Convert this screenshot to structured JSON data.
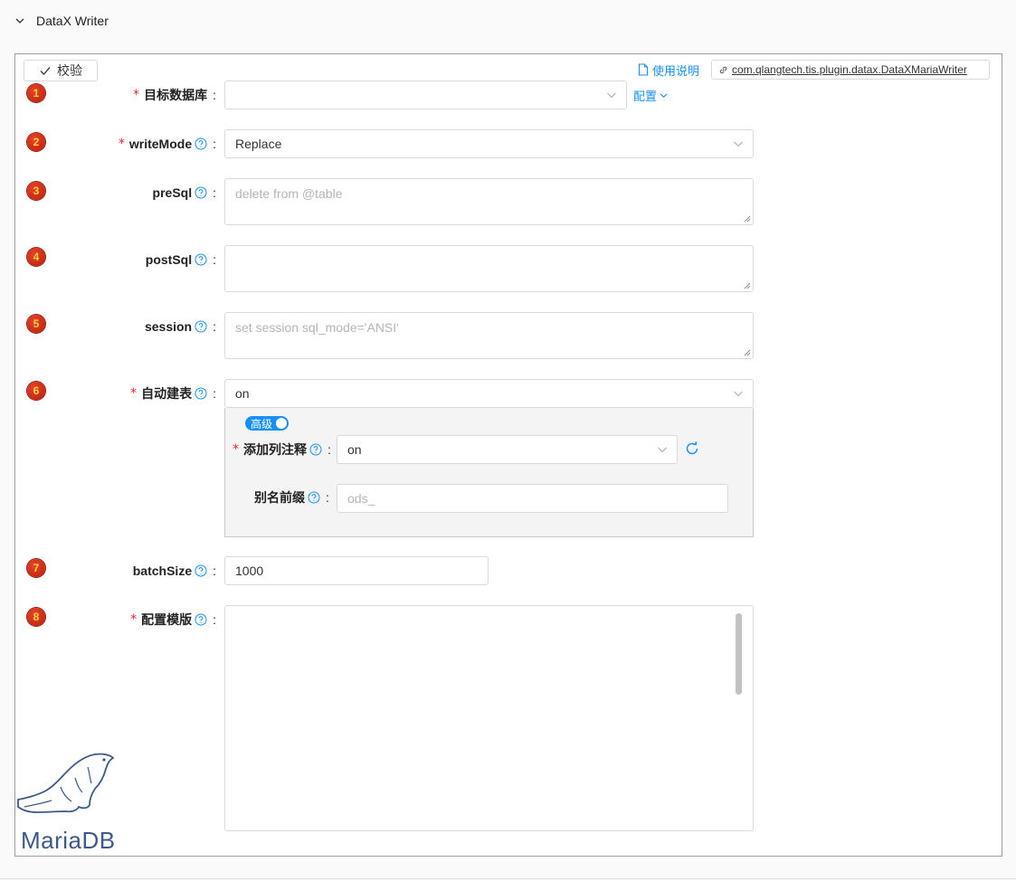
{
  "section": {
    "title": "DataX Writer"
  },
  "toolbar": {
    "verify_label": "校验",
    "doc_label": "使用说明",
    "plugin_class": "com.qlangtech.tis.plugin.datax.DataXMariaWriter"
  },
  "fields": {
    "target_db": {
      "index": "1",
      "label": "目标数据库",
      "value": "",
      "config_link": "配置"
    },
    "write_mode": {
      "index": "2",
      "label": "writeMode",
      "value": "Replace"
    },
    "pre_sql": {
      "index": "3",
      "label": "preSql",
      "placeholder": "delete from @table"
    },
    "post_sql": {
      "index": "4",
      "label": "postSql",
      "placeholder": ""
    },
    "session": {
      "index": "5",
      "label": "session",
      "placeholder": "set session sql_mode='ANSI'"
    },
    "auto_create": {
      "index": "6",
      "label": "自动建表",
      "value": "on",
      "advanced_toggle": "高级",
      "add_comment": {
        "label": "添加列注释",
        "value": "on"
      },
      "alias_prefix": {
        "label": "别名前缀",
        "placeholder": "ods_"
      }
    },
    "batch_size": {
      "index": "7",
      "label": "batchSize",
      "value": "1000"
    },
    "template": {
      "index": "8",
      "label": "配置模版",
      "value": ""
    }
  },
  "logo": {
    "text": "MariaDB"
  },
  "colors": {
    "accent": "#1890ff",
    "required": "#f5222d",
    "badge": "#c9230b",
    "logo": "#3c5a8c"
  }
}
